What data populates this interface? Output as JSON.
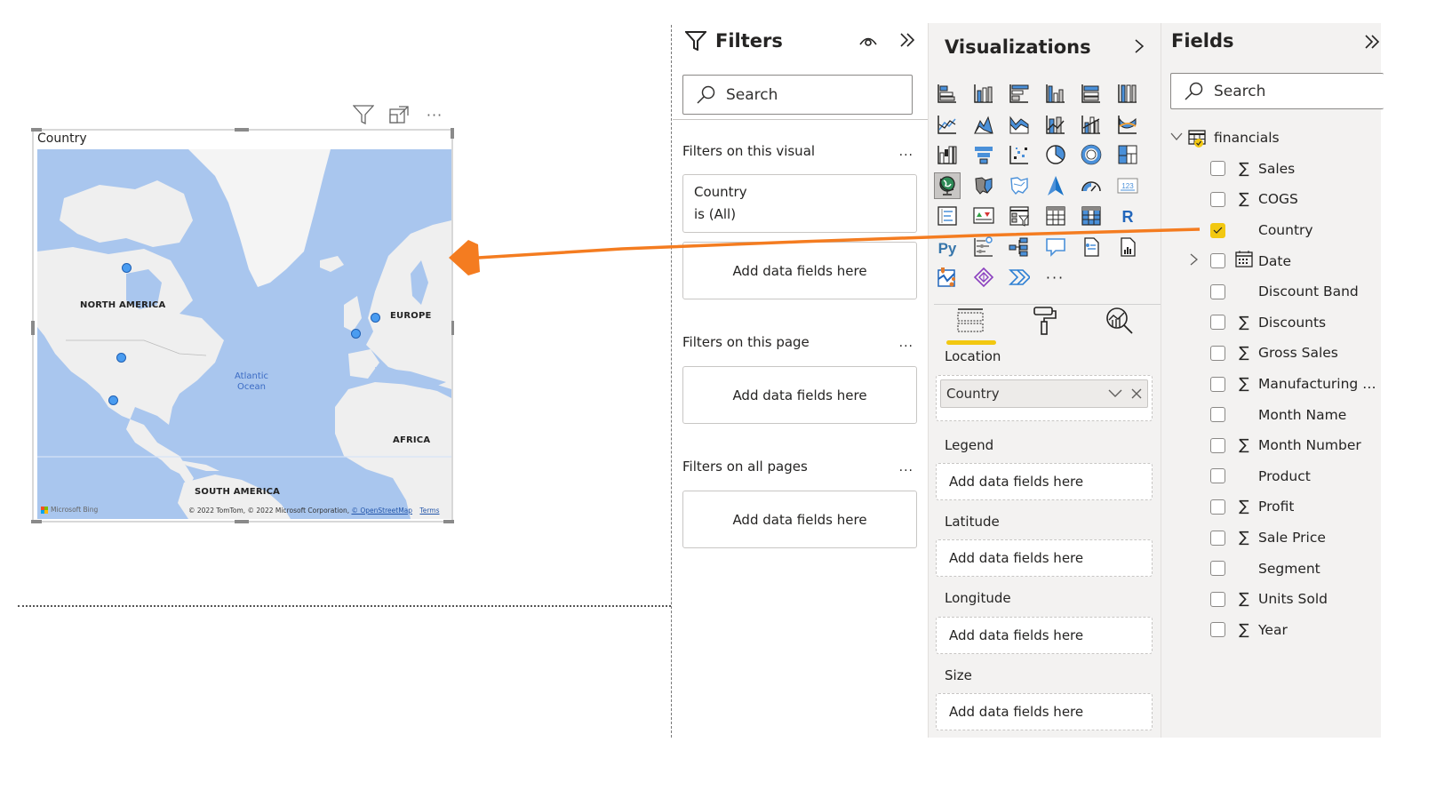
{
  "canvas": {
    "visual": {
      "title": "Country",
      "header_icons": [
        "filter-icon",
        "focus-mode-icon",
        "more-options-icon"
      ],
      "map": {
        "continent_labels": [
          "NORTH AMERICA",
          "EUROPE",
          "AFRICA",
          "SOUTH AMERICA"
        ],
        "ocean_label_line1": "Atlantic",
        "ocean_label_line2": "Ocean",
        "points": [
          {
            "country": "Canada"
          },
          {
            "country": "United States of America"
          },
          {
            "country": "Mexico"
          },
          {
            "country": "France"
          },
          {
            "country": "Germany"
          }
        ],
        "provider": "Microsoft Bing",
        "attribution": "© 2022 TomTom, © 2022 Microsoft Corporation,",
        "attribution_link": "© OpenStreetMap",
        "terms": "Terms"
      }
    },
    "annotation_color": "#f47c20"
  },
  "filters": {
    "title": "Filters",
    "search_placeholder": "Search",
    "sections": {
      "visual": {
        "label": "Filters on this visual",
        "more": "...",
        "card_field": "Country",
        "card_condition": "is (All)",
        "drop": "Add data fields here"
      },
      "page": {
        "label": "Filters on this page",
        "more": "...",
        "drop": "Add data fields here"
      },
      "all": {
        "label": "Filters on all pages",
        "more": "...",
        "drop": "Add data fields here"
      }
    }
  },
  "visualizations": {
    "title": "Visualizations",
    "icons": [
      "stacked-bar-chart",
      "stacked-column-chart",
      "clustered-bar-chart",
      "clustered-column-chart",
      "100-stacked-bar-chart",
      "100-stacked-column-chart",
      "line-chart",
      "area-chart",
      "stacked-area-chart",
      "line-and-stacked-column-chart",
      "line-and-clustered-column-chart",
      "ribbon-chart",
      "waterfall-chart",
      "funnel",
      "scatter-chart",
      "pie-chart",
      "donut-chart",
      "treemap",
      "map",
      "filled-map",
      "shape-map",
      "azure-map",
      "gauge",
      "card",
      "multi-row-card",
      "kpi",
      "slicer",
      "table",
      "matrix",
      "r-script-visual",
      "python-visual",
      "key-influencers",
      "decomposition-tree",
      "qa",
      "smart-narrative",
      "paginated-report",
      "arcgis-map",
      "power-apps",
      "power-automate",
      "more-visuals"
    ],
    "selected_icon": "map",
    "more_label": "...",
    "tabs": [
      "fields-tab",
      "format-tab",
      "analytics-tab"
    ],
    "active_tab": "fields-tab",
    "wells": {
      "location": {
        "label": "Location",
        "field": "Country"
      },
      "legend": {
        "label": "Legend",
        "placeholder": "Add data fields here"
      },
      "latitude": {
        "label": "Latitude",
        "placeholder": "Add data fields here"
      },
      "longitude": {
        "label": "Longitude",
        "placeholder": "Add data fields here"
      },
      "size": {
        "label": "Size",
        "placeholder": "Add data fields here"
      }
    }
  },
  "fields": {
    "title": "Fields",
    "search_placeholder": "Search",
    "table": {
      "name": "financials",
      "expanded": true,
      "items": [
        {
          "name": "Sales",
          "icon": "sigma",
          "checked": false
        },
        {
          "name": "COGS",
          "icon": "sigma",
          "checked": false
        },
        {
          "name": "Country",
          "icon": "",
          "checked": true
        },
        {
          "name": "Date",
          "icon": "calendar",
          "checked": false,
          "expandable": true
        },
        {
          "name": "Discount Band",
          "icon": "",
          "checked": false
        },
        {
          "name": "Discounts",
          "icon": "sigma",
          "checked": false
        },
        {
          "name": "Gross Sales",
          "icon": "sigma",
          "checked": false
        },
        {
          "name": "Manufacturing Price",
          "icon": "sigma",
          "checked": false
        },
        {
          "name": "Month Name",
          "icon": "",
          "checked": false
        },
        {
          "name": "Month Number",
          "icon": "sigma",
          "checked": false
        },
        {
          "name": "Product",
          "icon": "",
          "checked": false
        },
        {
          "name": "Profit",
          "icon": "sigma",
          "checked": false
        },
        {
          "name": "Sale Price",
          "icon": "sigma",
          "checked": false
        },
        {
          "name": "Segment",
          "icon": "",
          "checked": false
        },
        {
          "name": "Units Sold",
          "icon": "sigma",
          "checked": false
        },
        {
          "name": "Year",
          "icon": "sigma",
          "checked": false
        }
      ]
    },
    "accent_color": "#f2c811"
  }
}
